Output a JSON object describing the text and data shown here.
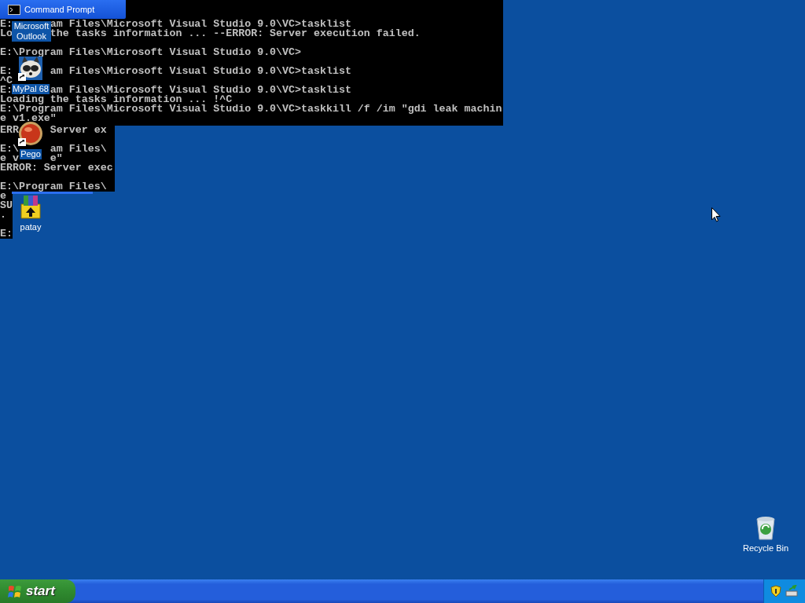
{
  "console_window": {
    "title": "Command Prompt",
    "blocks": [
      {
        "lines": [
          {
            "text": [
              "E:",
              "am Files\\Microsoft Visual Studio 9.0\\VC>tasklist"
            ],
            "blank_before": false
          },
          {
            "text": [
              "Lo",
              "the tasks information ... --ERROR: Server execution failed."
            ],
            "blank_before": false
          },
          {
            "text": [
              "E:\\Program Files\\Microsoft Visual Studio 9.0\\VC>"
            ],
            "blank_before": true
          },
          {
            "text": [
              "E:",
              "am Files\\Microsoft Visual Studio 9.0\\VC>tasklist"
            ],
            "blank_before": true
          },
          {
            "text": [
              "^C"
            ],
            "blank_before": false
          },
          {
            "text": [
              "E:",
              "am Files\\Microsoft Visual Studio 9.0\\VC>tasklist"
            ],
            "blank_before": false
          },
          {
            "text": [
              "Loading the tasks information ... !^C"
            ],
            "blank_before": false
          },
          {
            "text": [
              "E:\\Program Files\\Microsoft Visual Studio 9.0\\VC>taskkill /f /im \"gdi leak machin"
            ],
            "blank_before": false
          },
          {
            "text": [
              "e v1.exe\""
            ],
            "blank_before": false
          }
        ]
      },
      {
        "lines": [
          {
            "text": [
              "ERR",
              "Server ex"
            ],
            "blank_before": false
          },
          {
            "text": [
              "E:\\",
              "am Files\\"
            ],
            "blank_before": true
          },
          {
            "text": [
              "e v",
              "e\""
            ],
            "blank_before": false
          },
          {
            "text": [
              "ERROR: Server exec"
            ],
            "blank_before": false
          },
          {
            "text": [
              "E:\\Program Files\\"
            ],
            "blank_before": true
          }
        ]
      },
      {
        "lines": [
          {
            "text": [
              "e"
            ],
            "blank_before": false
          },
          {
            "text": [
              "SU"
            ],
            "blank_before": false
          },
          {
            "text": [
              "."
            ],
            "blank_before": false
          },
          {
            "text": [
              "E:"
            ],
            "blank_before": true
          }
        ]
      }
    ]
  },
  "desktop_icons": [
    {
      "label": "Microsoft Outlook",
      "kind": "hidden"
    },
    {
      "label": "MyPal 68",
      "kind": "raccoon",
      "shortcut": true
    },
    {
      "label": "Pego",
      "kind": "orb",
      "shortcut": true
    },
    {
      "label": "patay",
      "kind": "archive",
      "shortcut": false
    },
    {
      "label": "Recycle Bin",
      "kind": "recycle",
      "shortcut": false
    }
  ],
  "taskbar": {
    "start_label": "start"
  }
}
